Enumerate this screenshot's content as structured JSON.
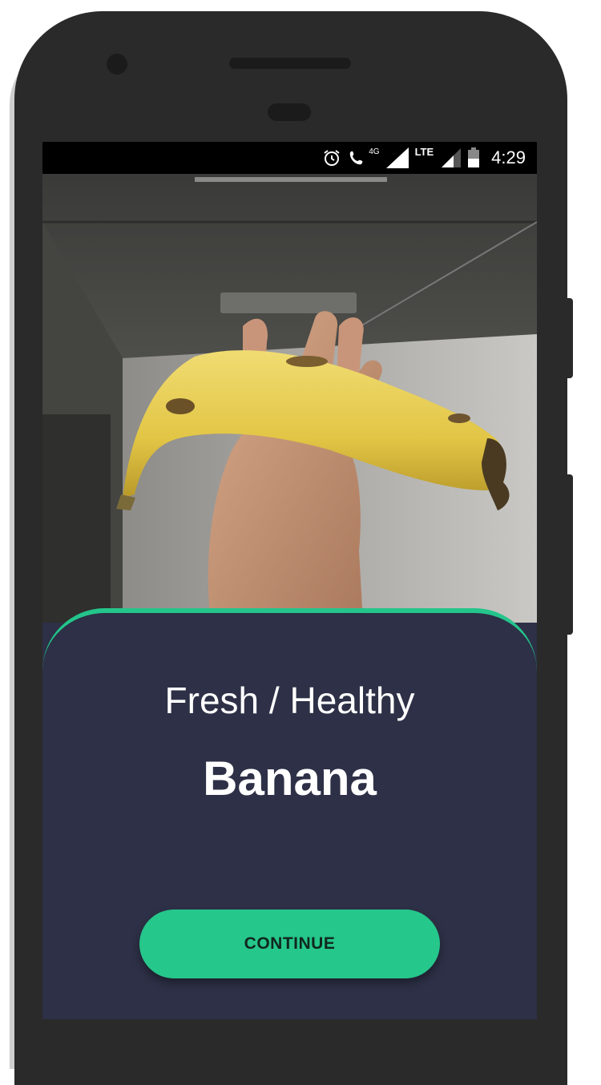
{
  "status_bar": {
    "network_badge": "4G",
    "lte_label": "LTE",
    "battery_level": "37",
    "time": "4:29",
    "icons": [
      "alarm-icon",
      "call-icon",
      "signal-icon",
      "signal-icon",
      "battery-icon"
    ]
  },
  "result": {
    "status": "Fresh / Healthy",
    "item": "Banana",
    "continue_label": "CONTINUE"
  },
  "colors": {
    "accent": "#24c58b",
    "card_background": "#2d3046",
    "status_bar": "#000000",
    "device_frame": "#2a2a2a"
  }
}
